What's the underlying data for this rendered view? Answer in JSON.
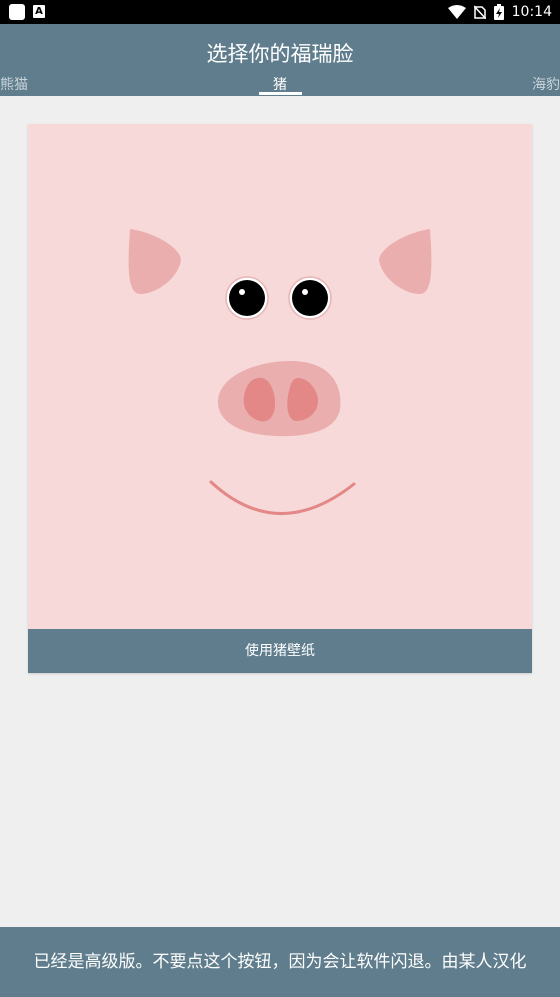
{
  "status_bar": {
    "time": "10:14",
    "icons": [
      "app-square-icon",
      "a-badge-icon",
      "wifi-icon",
      "no-sim-icon",
      "battery-charging-icon"
    ]
  },
  "header": {
    "title": "选择你的福瑞脸",
    "tabs": [
      {
        "label": "熊猫",
        "active": false
      },
      {
        "label": "猪",
        "active": true
      },
      {
        "label": "海豹",
        "active": false
      }
    ]
  },
  "card": {
    "button_label": "使用猪壁纸",
    "face_icon": "pig-face-illustration",
    "colors": {
      "background": "#f6d9d8",
      "ears": "#eaaeae",
      "snout": "#eaaeae",
      "nostrils": "#e38787",
      "smile": "#e38787"
    }
  },
  "bottom_bar": {
    "text": "已经是高级版。不要点这个按钮，因为会让软件闪退。由某人汉化"
  },
  "colors": {
    "primary": "#5f7d8c",
    "page_background": "#efefef"
  }
}
